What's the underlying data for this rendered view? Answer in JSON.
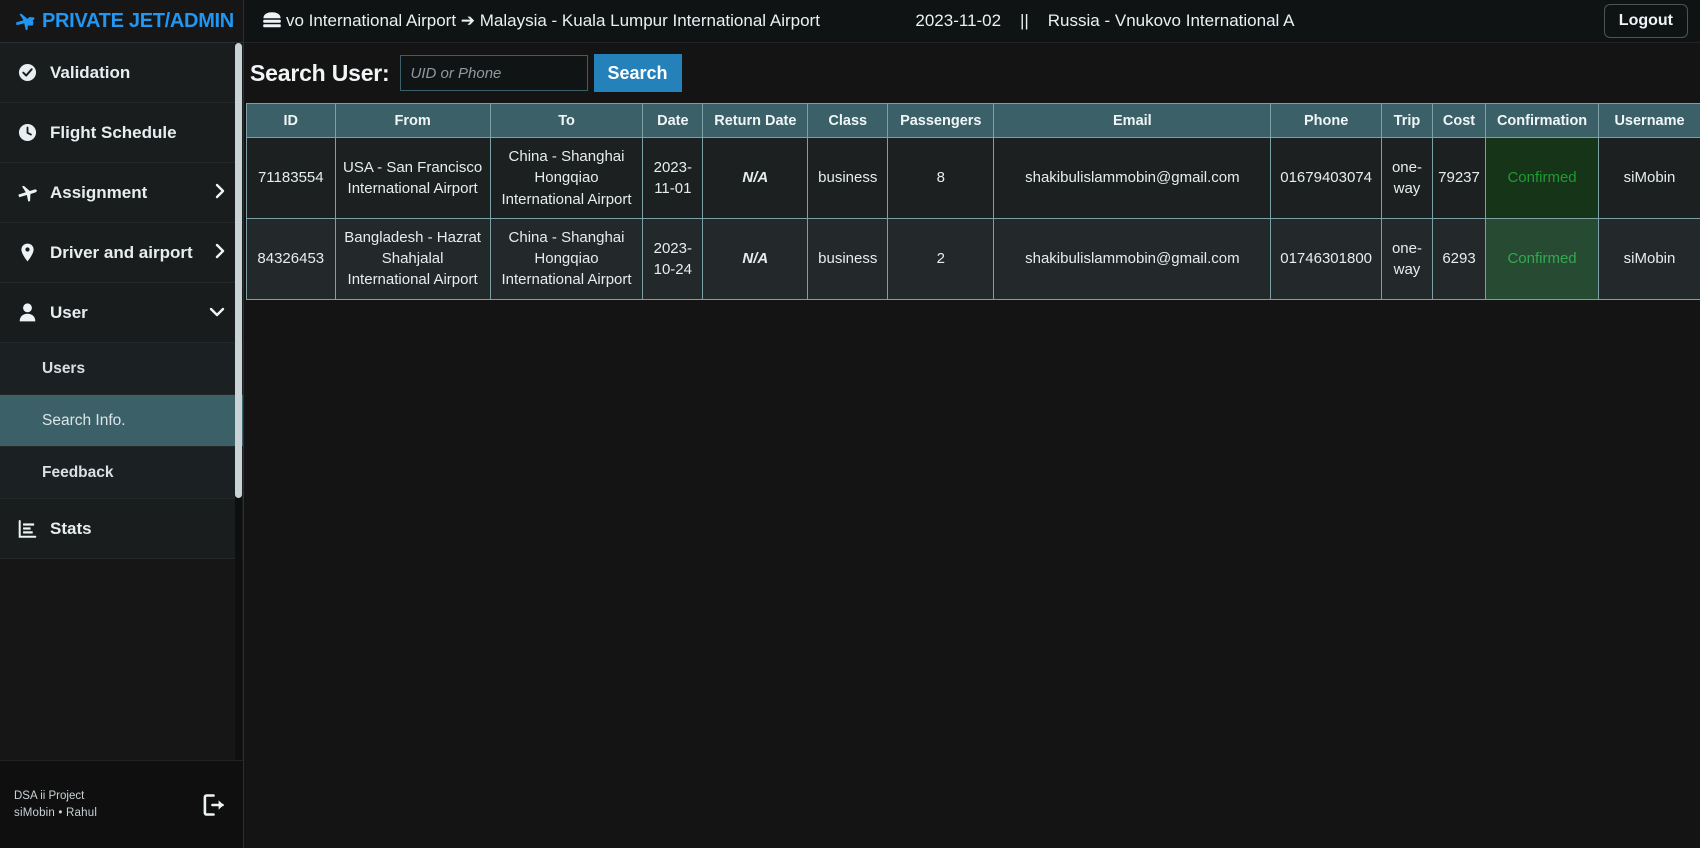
{
  "brand": {
    "title": "PRIVATE JET/ADMIN"
  },
  "sidebar": {
    "items": [
      {
        "label": "Validation",
        "icon": "check-circle-icon",
        "chevron": ""
      },
      {
        "label": "Flight Schedule",
        "icon": "clock-icon",
        "chevron": ""
      },
      {
        "label": "Assignment",
        "icon": "plane-icon",
        "chevron": "›"
      },
      {
        "label": "Driver and airport",
        "icon": "map-pin-icon",
        "chevron": "›"
      },
      {
        "label": "User",
        "icon": "user-icon",
        "chevron": "⌄"
      }
    ],
    "sub_items": [
      {
        "label": "Users",
        "selected": false
      },
      {
        "label": "Search Info.",
        "selected": true
      },
      {
        "label": "Feedback",
        "selected": false
      }
    ],
    "stats": {
      "label": "Stats",
      "icon": "bar-chart-icon"
    },
    "footer": {
      "line1": "DSA ii Project",
      "line2": "siMobin  •  Rahul",
      "logout_icon": "sign-out-icon"
    }
  },
  "topbar": {
    "menu_icon": "hamburger-icon",
    "ticker_1": "covo International Airport ➔ Malaysia - Kuala Lumpur International Airport",
    "ticker_date": "2023-11-02",
    "ticker_sep": "||",
    "ticker_2": "Russia - Vnukovo International A",
    "logout_label": "Logout"
  },
  "search": {
    "label": "Search User:",
    "placeholder": "UID or Phone",
    "value": "",
    "button_label": "Search"
  },
  "table": {
    "columns": [
      "ID",
      "From",
      "To",
      "Date",
      "Return Date",
      "Class",
      "Passengers",
      "Email",
      "Phone",
      "Trip",
      "Cost",
      "Confirmation",
      "Username"
    ],
    "rows": [
      {
        "id": "71183554",
        "from": "USA - San Francisco International Airport",
        "to": "China - Shanghai Hongqiao International Airport",
        "date": "2023-11-01",
        "return_date": "N/A",
        "class": "business",
        "passengers": "8",
        "email": "shakibulislammobin@gmail.com",
        "phone": "01679403074",
        "trip": "one-way",
        "cost": "79237",
        "confirmation": "Confirmed",
        "username": "siMobin"
      },
      {
        "id": "84326453",
        "from": "Bangladesh - Hazrat Shahjalal International Airport",
        "to": "China - Shanghai Hongqiao International Airport",
        "date": "2023-10-24",
        "return_date": "N/A",
        "class": "business",
        "passengers": "2",
        "email": "shakibulislammobin@gmail.com",
        "phone": "01746301800",
        "trip": "one-way",
        "cost": "6293",
        "confirmation": "Confirmed",
        "username": "siMobin"
      }
    ]
  },
  "colors": {
    "accent_blue": "#2196f3",
    "search_button": "#2481ba",
    "table_header": "#3b6068",
    "confirmed_text": "#1f9c33",
    "na_text": "#e8202b"
  }
}
